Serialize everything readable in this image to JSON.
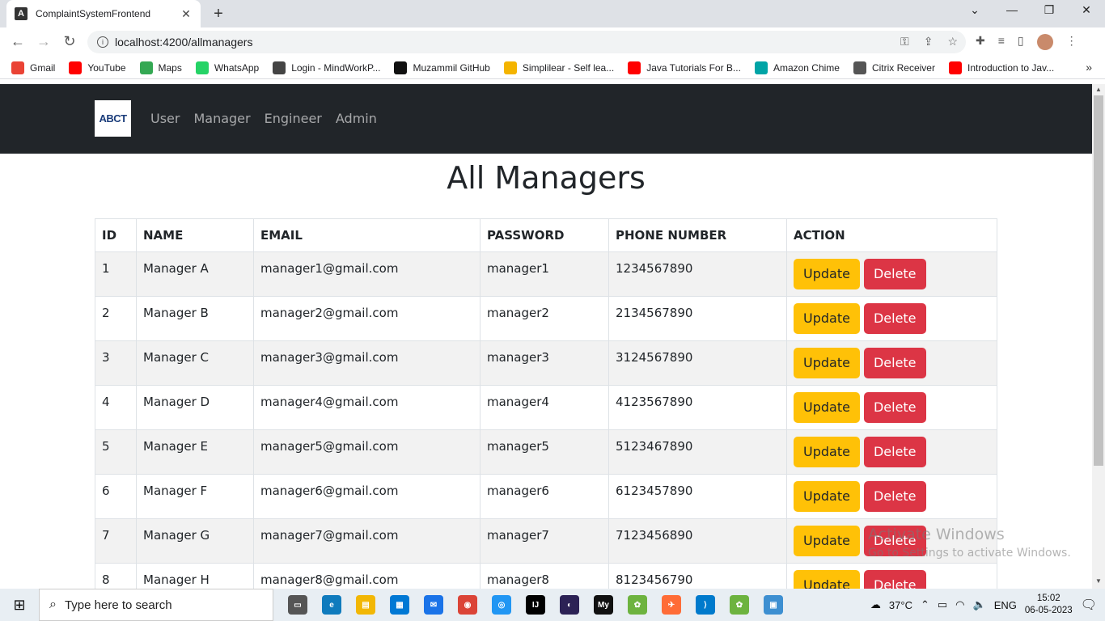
{
  "browser": {
    "tab_title": "ComplaintSystemFrontend",
    "url": "localhost:4200/allmanagers",
    "bookmarks": [
      {
        "label": "Gmail",
        "color": "#ea4335"
      },
      {
        "label": "YouTube",
        "color": "#ff0000"
      },
      {
        "label": "Maps",
        "color": "#34a853"
      },
      {
        "label": "WhatsApp",
        "color": "#25d366"
      },
      {
        "label": "Login - MindWorkP...",
        "color": "#444444"
      },
      {
        "label": "Muzammil GitHub",
        "color": "#111111"
      },
      {
        "label": "Simplilear - Self lea...",
        "color": "#f4b400"
      },
      {
        "label": "Java Tutorials For B...",
        "color": "#ff0000"
      },
      {
        "label": "Amazon Chime",
        "color": "#00a4a6"
      },
      {
        "label": "Citrix Receiver",
        "color": "#555555"
      },
      {
        "label": "Introduction to Jav...",
        "color": "#ff0000"
      }
    ]
  },
  "navbar": {
    "brand": "ABCT",
    "links": [
      "User",
      "Manager",
      "Engineer",
      "Admin"
    ]
  },
  "page": {
    "title": "All Managers"
  },
  "table": {
    "headers": [
      "ID",
      "NAME",
      "EMAIL",
      "PASSWORD",
      "PHONE NUMBER",
      "ACTION"
    ],
    "rows": [
      [
        "1",
        "Manager A",
        "manager1@gmail.com",
        "manager1",
        "1234567890"
      ],
      [
        "2",
        "Manager B",
        "manager2@gmail.com",
        "manager2",
        "2134567890"
      ],
      [
        "3",
        "Manager C",
        "manager3@gmail.com",
        "manager3",
        "3124567890"
      ],
      [
        "4",
        "Manager D",
        "manager4@gmail.com",
        "manager4",
        "4123567890"
      ],
      [
        "5",
        "Manager E",
        "manager5@gmail.com",
        "manager5",
        "5123467890"
      ],
      [
        "6",
        "Manager F",
        "manager6@gmail.com",
        "manager6",
        "6123457890"
      ],
      [
        "7",
        "Manager G",
        "manager7@gmail.com",
        "manager7",
        "7123456890"
      ],
      [
        "8",
        "Manager H",
        "manager8@gmail.com",
        "manager8",
        "8123456790"
      ]
    ],
    "update_label": "Update",
    "delete_label": "Delete"
  },
  "watermark": {
    "line1": "Activate Windows",
    "line2": "Go to Settings to activate Windows."
  },
  "taskbar": {
    "search_placeholder": "Type here to search",
    "weather": "37°C",
    "language": "ENG",
    "time": "15:02",
    "date": "06-05-2023"
  }
}
